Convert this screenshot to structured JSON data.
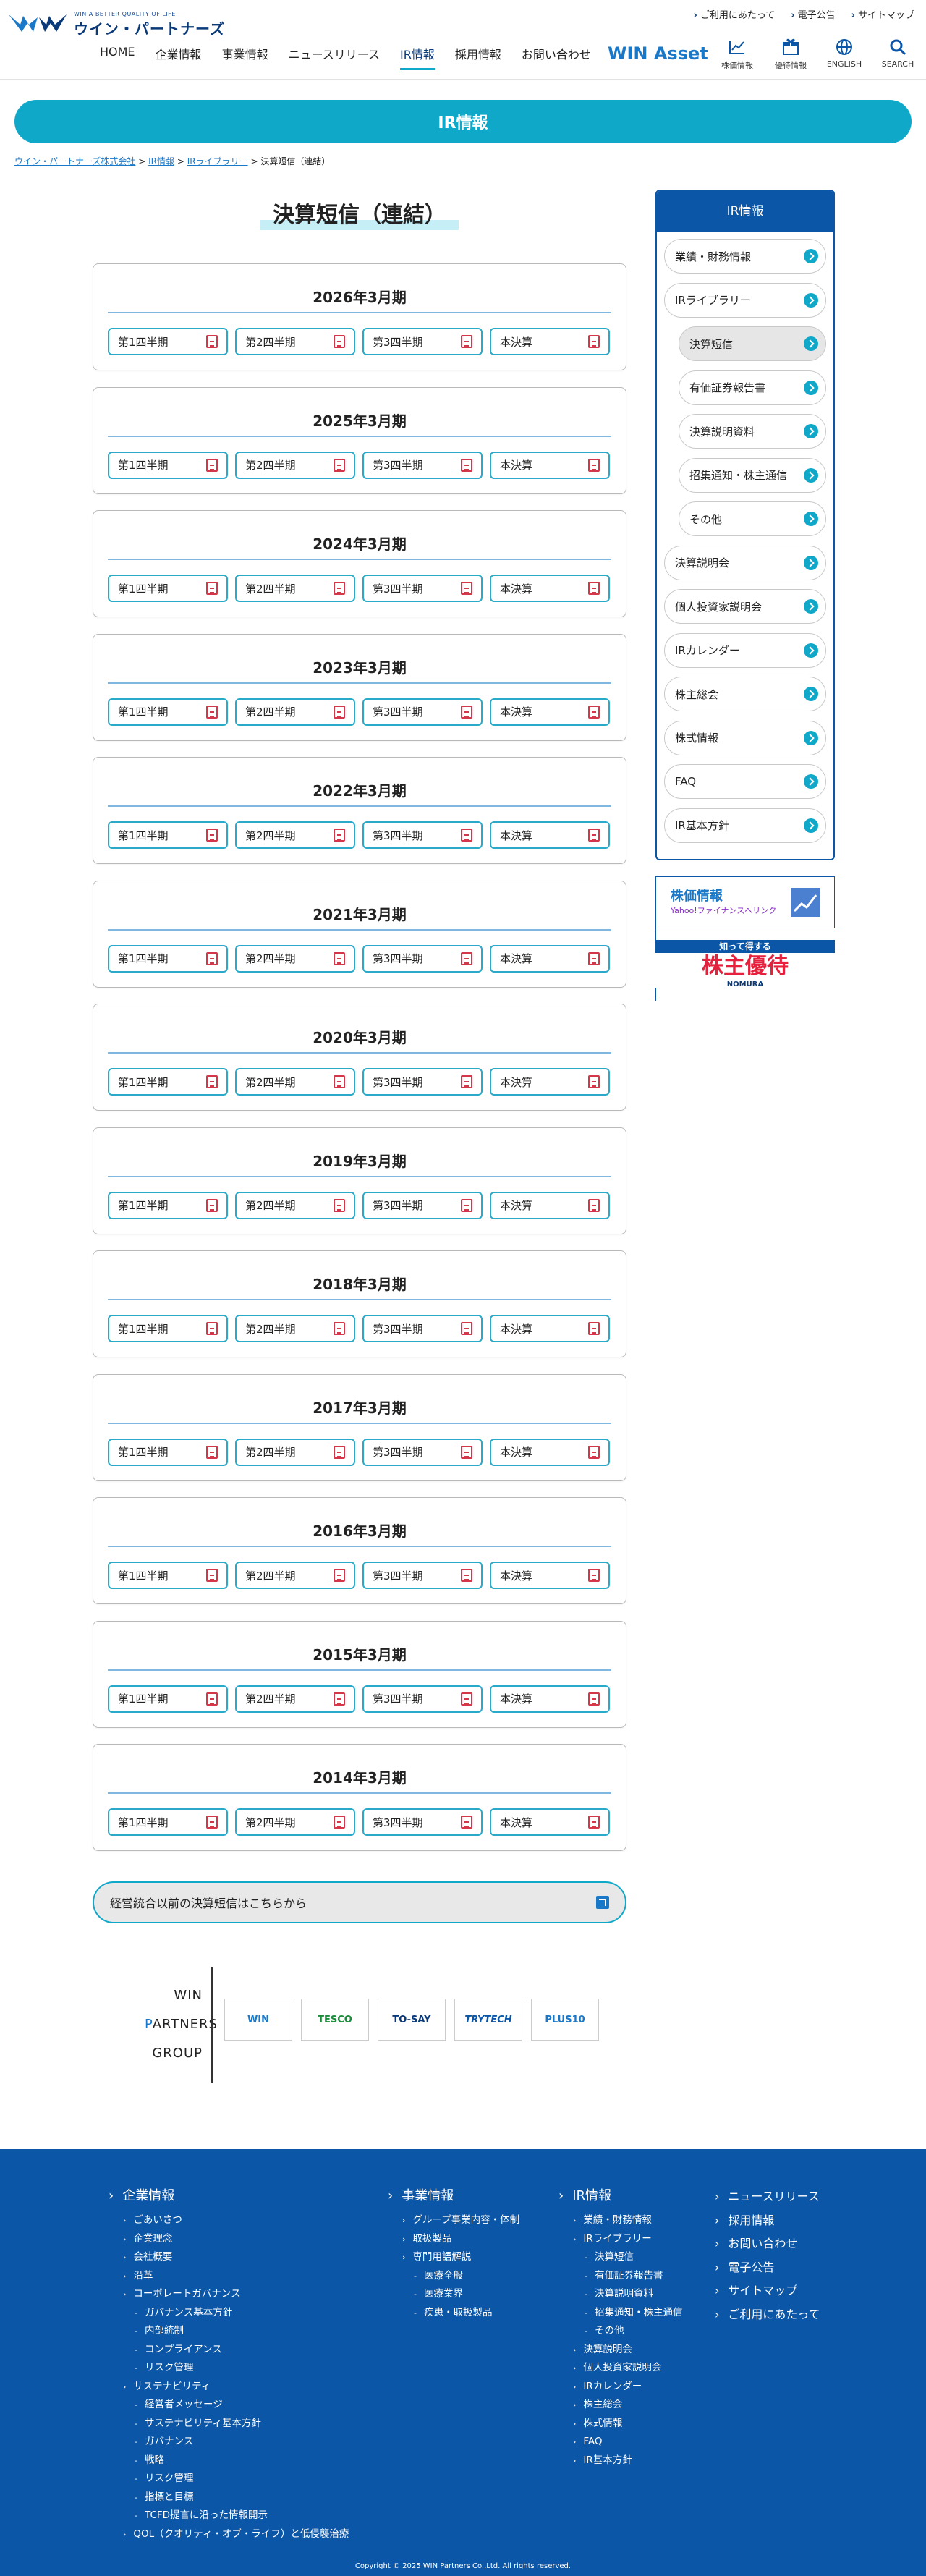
{
  "header": {
    "logo_tagline": "WIN A BETTER QUALITY OF LIFE",
    "logo_name": "ウイン・パートナーズ",
    "utility_links": [
      "ご利用にあたって",
      "電子公告",
      "サイトマップ"
    ],
    "nav": [
      "HOME",
      "企業情報",
      "事業情報",
      "ニュースリリース",
      "IR情報",
      "採用情報",
      "お問い合わせ"
    ],
    "nav_active_index": 4,
    "win_asset": "WIN Asset",
    "icon_nav": [
      {
        "label": "株価情報",
        "icon": "stock-chart-icon"
      },
      {
        "label": "優待情報",
        "icon": "gift-icon"
      },
      {
        "label": "ENGLISH",
        "icon": "globe-icon"
      },
      {
        "label": "SEARCH",
        "icon": "search-icon"
      }
    ]
  },
  "banner_title": "IR情報",
  "breadcrumb": {
    "items": [
      "ウイン・パートナーズ株式会社",
      "IR情報",
      "IRライブラリー"
    ],
    "current": "決算短信（連結）",
    "sep": ">"
  },
  "page_title": "決算短信（連結）",
  "quarters": [
    "第1四半期",
    "第2四半期",
    "第3四半期",
    "本決算"
  ],
  "years": [
    "2026年3月期",
    "2025年3月期",
    "2024年3月期",
    "2023年3月期",
    "2022年3月期",
    "2021年3月期",
    "2020年3月期",
    "2019年3月期",
    "2018年3月期",
    "2017年3月期",
    "2016年3月期",
    "2015年3月期",
    "2014年3月期"
  ],
  "prev_link": "経営統合以前の決算短信はこちらから",
  "group": {
    "name_lines": [
      "WIN",
      "PARTNERS",
      "GROUP"
    ],
    "logos": [
      "WIN",
      "TESCO",
      "TO-SAY",
      "TRYTECH",
      "PLUS10"
    ]
  },
  "sidebar": {
    "title": "IR情報",
    "items": [
      {
        "label": "業績・財務情報",
        "sub": false,
        "current": false
      },
      {
        "label": "IRライブラリー",
        "sub": false,
        "current": false
      },
      {
        "label": "決算短信",
        "sub": true,
        "current": true
      },
      {
        "label": "有価証券報告書",
        "sub": true,
        "current": false
      },
      {
        "label": "決算説明資料",
        "sub": true,
        "current": false
      },
      {
        "label": "招集通知・株主通信",
        "sub": true,
        "current": false
      },
      {
        "label": "その他",
        "sub": true,
        "current": false
      },
      {
        "label": "決算説明会",
        "sub": false,
        "current": false
      },
      {
        "label": "個人投資家説明会",
        "sub": false,
        "current": false
      },
      {
        "label": "IRカレンダー",
        "sub": false,
        "current": false
      },
      {
        "label": "株主総会",
        "sub": false,
        "current": false
      },
      {
        "label": "株式情報",
        "sub": false,
        "current": false
      },
      {
        "label": "FAQ",
        "sub": false,
        "current": false
      },
      {
        "label": "IR基本方針",
        "sub": false,
        "current": false
      }
    ],
    "banner_stock": {
      "title": "株価情報",
      "sub": "Yahoo!ファイナンスへリンク"
    },
    "banner_yutai": {
      "top": "知って得する",
      "main": "株主優待",
      "foot": "NOMURA"
    }
  },
  "footer": {
    "col1": {
      "head": "企業情報",
      "items": [
        {
          "t": "ごあいさつ",
          "lvl": 1
        },
        {
          "t": "企業理念",
          "lvl": 1
        },
        {
          "t": "会社概要",
          "lvl": 1
        },
        {
          "t": "沿革",
          "lvl": 1
        },
        {
          "t": "コーポレートガバナンス",
          "lvl": 1
        },
        {
          "t": "ガバナンス基本方針",
          "lvl": 2
        },
        {
          "t": "内部統制",
          "lvl": 2
        },
        {
          "t": "コンプライアンス",
          "lvl": 2
        },
        {
          "t": "リスク管理",
          "lvl": 2
        },
        {
          "t": "サステナビリティ",
          "lvl": 1
        },
        {
          "t": "経営者メッセージ",
          "lvl": 2
        },
        {
          "t": "サステナビリティ基本方針",
          "lvl": 2
        },
        {
          "t": "ガバナンス",
          "lvl": 2
        },
        {
          "t": "戦略",
          "lvl": 2
        },
        {
          "t": "リスク管理",
          "lvl": 2
        },
        {
          "t": "指標と目標",
          "lvl": 2
        },
        {
          "t": "TCFD提言に沿った情報開示",
          "lvl": 2
        },
        {
          "t": "QOL（クオリティ・オブ・ライフ）と低侵襲治療",
          "lvl": 1
        }
      ]
    },
    "col2": {
      "head": "事業情報",
      "items": [
        {
          "t": "グループ事業内容・体制",
          "lvl": 1
        },
        {
          "t": "取扱製品",
          "lvl": 1
        },
        {
          "t": "専門用語解説",
          "lvl": 1
        },
        {
          "t": "医療全般",
          "lvl": 2
        },
        {
          "t": "医療業界",
          "lvl": 2
        },
        {
          "t": "疾患・取扱製品",
          "lvl": 2
        }
      ]
    },
    "col3": {
      "head": "IR情報",
      "items": [
        {
          "t": "業績・財務情報",
          "lvl": 1
        },
        {
          "t": "IRライブラリー",
          "lvl": 1
        },
        {
          "t": "決算短信",
          "lvl": 2
        },
        {
          "t": "有価証券報告書",
          "lvl": 2
        },
        {
          "t": "決算説明資料",
          "lvl": 2
        },
        {
          "t": "招集通知・株主通信",
          "lvl": 2
        },
        {
          "t": "その他",
          "lvl": 2
        },
        {
          "t": "決算説明会",
          "lvl": 1
        },
        {
          "t": "個人投資家説明会",
          "lvl": 1
        },
        {
          "t": "IRカレンダー",
          "lvl": 1
        },
        {
          "t": "株主総会",
          "lvl": 1
        },
        {
          "t": "株式情報",
          "lvl": 1
        },
        {
          "t": "FAQ",
          "lvl": 1
        },
        {
          "t": "IR基本方針",
          "lvl": 1
        }
      ]
    },
    "col4": [
      "ニュースリリース",
      "採用情報",
      "お問い合わせ",
      "電子公告",
      "サイトマップ",
      "ご利用にあたって"
    ],
    "copyright": "Copyright © 2025 WIN Partners Co.,Ltd. All rights reserved."
  },
  "colors": {
    "brand_navy": "#0b56a7",
    "accent_cyan": "#10a8c9",
    "pdf_red": "#d4364a"
  }
}
